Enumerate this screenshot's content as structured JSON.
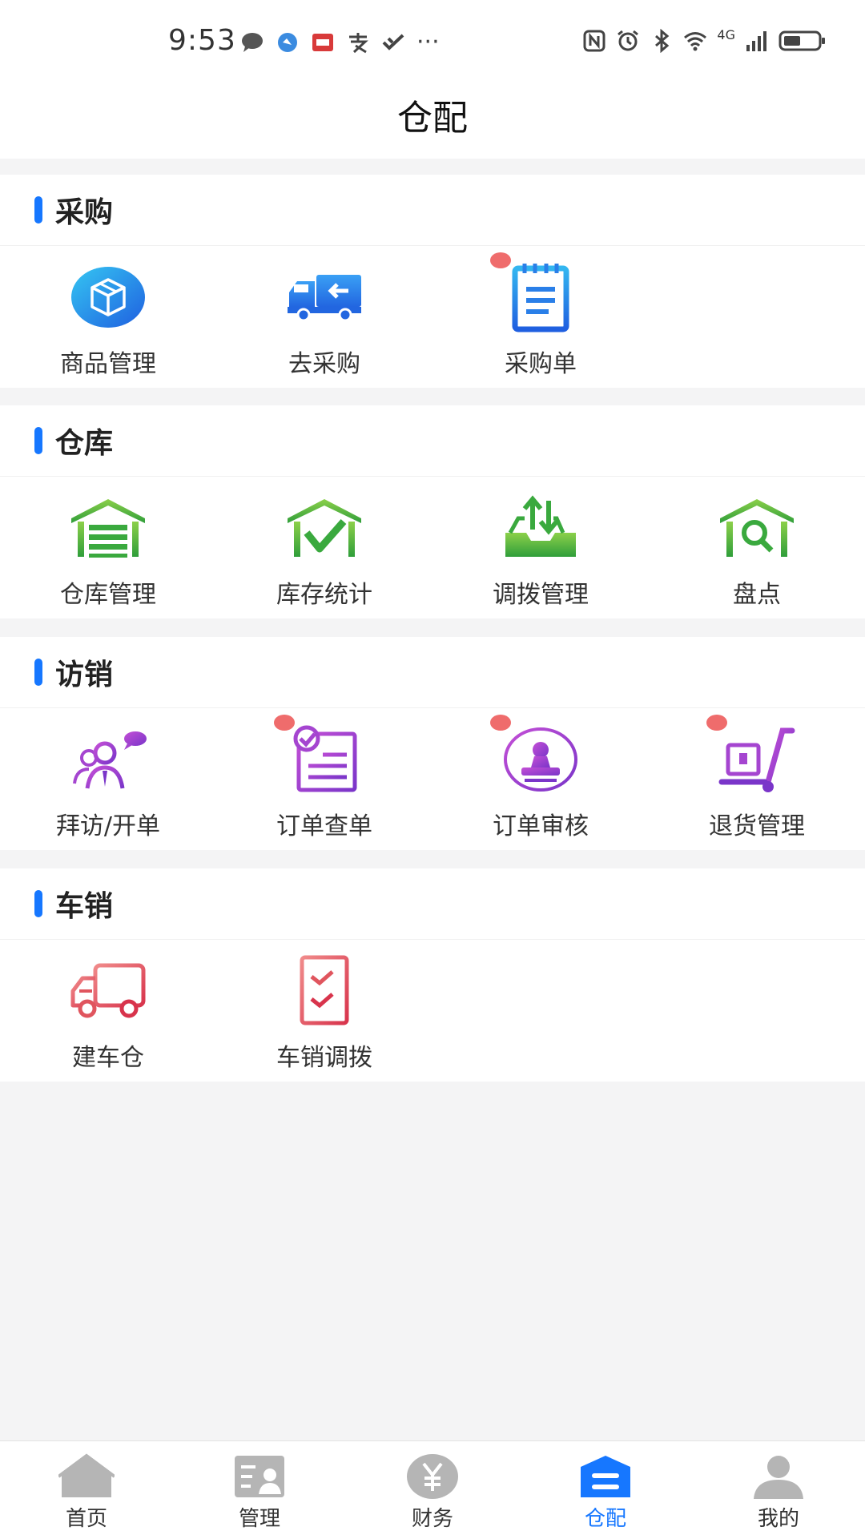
{
  "status_bar": {
    "time": "9:53",
    "network": "4G",
    "more": "···"
  },
  "header": {
    "title": "仓配"
  },
  "sections": [
    {
      "title": "采购",
      "items": [
        {
          "label": "商品管理",
          "icon": "box-icon",
          "badge": false
        },
        {
          "label": "去采购",
          "icon": "delivery-truck-icon",
          "badge": false
        },
        {
          "label": "采购单",
          "icon": "notepad-icon",
          "badge": true
        }
      ]
    },
    {
      "title": "仓库",
      "items": [
        {
          "label": "仓库管理",
          "icon": "warehouse-icon",
          "badge": false
        },
        {
          "label": "库存统计",
          "icon": "warehouse-check-icon",
          "badge": false
        },
        {
          "label": "调拨管理",
          "icon": "transfer-tray-icon",
          "badge": false
        },
        {
          "label": "盘点",
          "icon": "warehouse-search-icon",
          "badge": false
        }
      ]
    },
    {
      "title": "访销",
      "items": [
        {
          "label": "拜访/开单",
          "icon": "visit-people-icon",
          "badge": false
        },
        {
          "label": "订单查单",
          "icon": "order-checklist-icon",
          "badge": true
        },
        {
          "label": "订单审核",
          "icon": "stamp-icon",
          "badge": true
        },
        {
          "label": "退货管理",
          "icon": "hand-cart-icon",
          "badge": true
        }
      ]
    },
    {
      "title": "车销",
      "items": [
        {
          "label": "建车仓",
          "icon": "truck-outline-icon",
          "badge": false
        },
        {
          "label": "车销调拨",
          "icon": "checklist-icon",
          "badge": false
        }
      ]
    }
  ],
  "bottom_nav": [
    {
      "label": "首页",
      "icon": "home-icon",
      "active": false
    },
    {
      "label": "管理",
      "icon": "management-icon",
      "active": false
    },
    {
      "label": "财务",
      "icon": "yuan-icon",
      "active": false
    },
    {
      "label": "仓配",
      "icon": "warehouse-nav-icon",
      "active": true
    },
    {
      "label": "我的",
      "icon": "user-icon",
      "active": false
    }
  ],
  "colors": {
    "accent": "#1677ff",
    "badge": "#ef6c6c",
    "purchase_blue": "#2b7cf0",
    "warehouse_green": "#3aa93e",
    "sales_purple": "#9a3fd0",
    "vehicle_red": "#e0555e",
    "nav_gray": "#b5b5b5"
  }
}
